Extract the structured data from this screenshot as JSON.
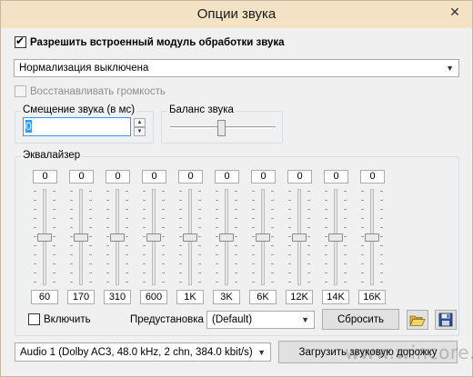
{
  "window": {
    "title": "Опции звука",
    "close_glyph": "✕"
  },
  "enable_processing": {
    "label": "Разрешить встроенный модуль обработки звука",
    "checked": true
  },
  "normalization": {
    "value": "Нормализация выключена"
  },
  "restore_volume": {
    "label": "Восстанавливать громкость",
    "checked": false,
    "disabled": true
  },
  "shift": {
    "title": "Смещение звука (в мс)",
    "value": "0"
  },
  "balance": {
    "title": "Баланс звука",
    "position": 0.5
  },
  "equalizer": {
    "title": "Эквалайзер",
    "bands": [
      {
        "value": "0",
        "label": "60"
      },
      {
        "value": "0",
        "label": "170"
      },
      {
        "value": "0",
        "label": "310"
      },
      {
        "value": "0",
        "label": "600"
      },
      {
        "value": "0",
        "label": "1K"
      },
      {
        "value": "0",
        "label": "3K"
      },
      {
        "value": "0",
        "label": "6K"
      },
      {
        "value": "0",
        "label": "12K"
      },
      {
        "value": "0",
        "label": "14K"
      },
      {
        "value": "0",
        "label": "16K"
      }
    ],
    "enable_label": "Включить",
    "preset_label": "Предустановка",
    "preset_value": "(Default)",
    "reset_label": "Сбросить"
  },
  "audio_track": {
    "value": "Audio 1 (Dolby AC3, 48.0 kHz, 2 chn, 384.0 kbit/s)"
  },
  "load_track_label": "Загрузить звуковую дорожку",
  "watermark": "www.wincore.ru",
  "icons": {
    "open": "folder-open-icon",
    "save": "floppy-save-icon"
  }
}
